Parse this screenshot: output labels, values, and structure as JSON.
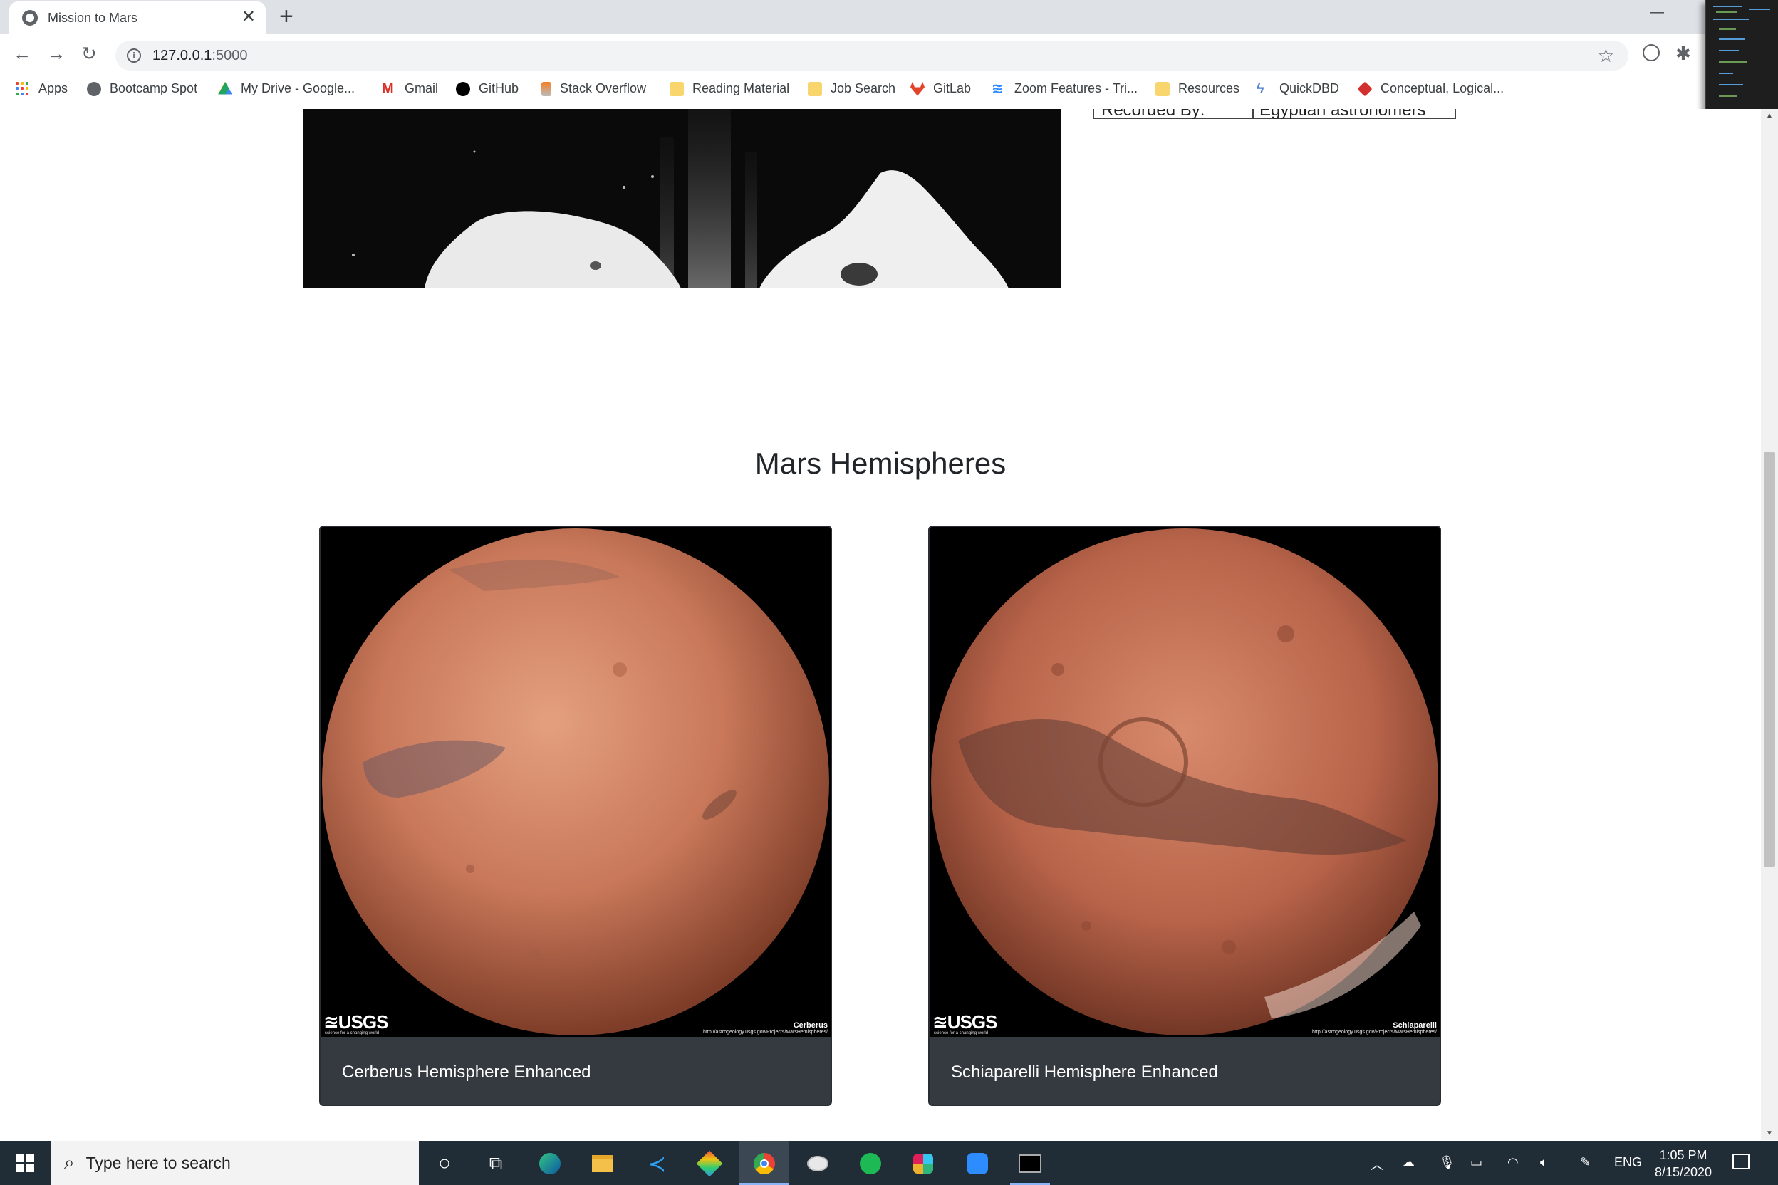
{
  "browser": {
    "tab_title": "Mission to Mars",
    "tab_close": "✕",
    "new_tab": "+",
    "url_host": "127.0.0.1",
    "url_port": ":5000"
  },
  "bookmarks": [
    {
      "label": "Apps",
      "icon": "apps-grid-icon"
    },
    {
      "label": "Bootcamp Spot",
      "icon": "globe-icon",
      "color": "#5f6368"
    },
    {
      "label": "My Drive - Google...",
      "icon": "google-drive-icon",
      "color": "#1fa463"
    },
    {
      "label": "Gmail",
      "icon": "gmail-icon",
      "color": "#d93025"
    },
    {
      "label": "GitHub",
      "icon": "github-icon",
      "color": "#000000"
    },
    {
      "label": "Stack Overflow",
      "icon": "stackoverflow-icon",
      "color": "#f48024"
    },
    {
      "label": "Reading Material",
      "icon": "folder-icon",
      "color": "#f9d56e"
    },
    {
      "label": "Job Search",
      "icon": "folder-icon",
      "color": "#f9d56e"
    },
    {
      "label": "GitLab",
      "icon": "gitlab-icon",
      "color": "#e24329"
    },
    {
      "label": "Zoom Features - Tri...",
      "icon": "zoom-icon",
      "color": "#2d8cff"
    },
    {
      "label": "Resources",
      "icon": "folder-icon",
      "color": "#f9d56e"
    },
    {
      "label": "QuickDBD",
      "icon": "quickdbd-icon",
      "color": "#4a7bd0"
    },
    {
      "label": "Conceptual, Logical...",
      "icon": "diamond-icon",
      "color": "#d32f2f"
    }
  ],
  "page": {
    "facts_row_label": "Recorded By:",
    "facts_row_value": "Egyptian astronomers",
    "section_title": "Mars Hemispheres",
    "hemispheres": [
      {
        "title": "Cerberus Hemisphere Enhanced",
        "credit": "Cerberus",
        "url": "http://astrogeology.usgs.gov/Projects/MarsHemispheres/",
        "logo": "≊USGS",
        "tagline": "science for a changing world"
      },
      {
        "title": "Schiaparelli Hemisphere Enhanced",
        "credit": "Schiaparelli",
        "url": "http://astrogeology.usgs.gov/Projects/MarsHemispheres/",
        "logo": "≊USGS",
        "tagline": "science for a changing world"
      }
    ]
  },
  "taskbar": {
    "search_placeholder": "Type here to search",
    "language": "ENG",
    "time": "1:05 PM",
    "date": "8/15/2020"
  },
  "colors": {
    "card_bg": "#343a40",
    "taskbar_bg": "#202c36",
    "mars_light": "#d8866a",
    "mars_dark": "#7a3b24"
  }
}
